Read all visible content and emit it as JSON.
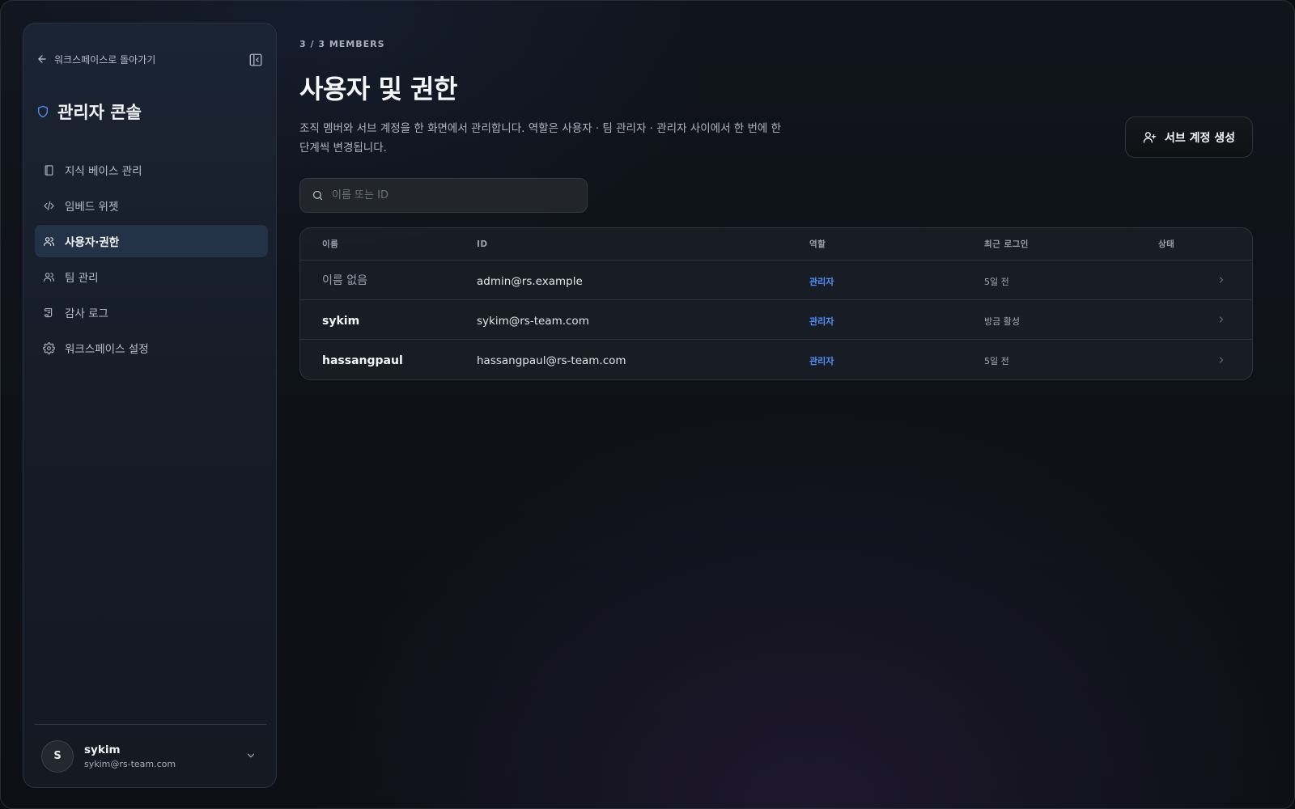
{
  "sidebar": {
    "back_label": "워크스페이스로 돌아가기",
    "console_title": "관리자 콘솔",
    "items": [
      {
        "label": "지식 베이스 관리"
      },
      {
        "label": "임베드 위젯"
      },
      {
        "label": "사용자·권한"
      },
      {
        "label": "팀 관리"
      },
      {
        "label": "감사 로그"
      },
      {
        "label": "워크스페이스 설정"
      }
    ],
    "active_index": 2,
    "user": {
      "initial": "S",
      "name": "sykim",
      "email": "sykim@rs-team.com"
    }
  },
  "main": {
    "eyebrow": "3 / 3 MEMBERS",
    "title": "사용자 및 권한",
    "description": "조직 멤버와 서브 계정을 한 화면에서 관리합니다. 역할은 사용자 · 팀 관리자 · 관리자 사이에서 한 번에 한 단계씩 변경됩니다.",
    "create_button_label": "서브 계정 생성",
    "search": {
      "placeholder": "이름 또는 ID",
      "value": ""
    },
    "table": {
      "columns": [
        "이름",
        "ID",
        "역할",
        "최근 로그인",
        "상태"
      ],
      "rows": [
        {
          "name": "이름 없음",
          "id": "admin@rs.example",
          "role": "관리자",
          "last_login": "5일 전"
        },
        {
          "name": "sykim",
          "id": "sykim@rs-team.com",
          "role": "관리자",
          "last_login": "방금 활성"
        },
        {
          "name": "hassangpaul",
          "id": "hassangpaul@rs-team.com",
          "role": "관리자",
          "last_login": "5일 전"
        }
      ]
    }
  },
  "colors": {
    "accent": "#4f8ff7",
    "sidebar_active_bg": "#243248",
    "background": "#0c0e13"
  },
  "icons": {
    "back": "arrow-left-icon",
    "collapse": "sidebar-collapse-icon",
    "console": "shield-icon",
    "nav": [
      "book-icon",
      "code-icon",
      "users-icon",
      "users-icon",
      "scroll-icon",
      "gear-icon"
    ],
    "create": "user-plus-icon",
    "search": "search-icon",
    "row": "chevron-right-icon",
    "user_menu": "chevron-down-icon"
  }
}
